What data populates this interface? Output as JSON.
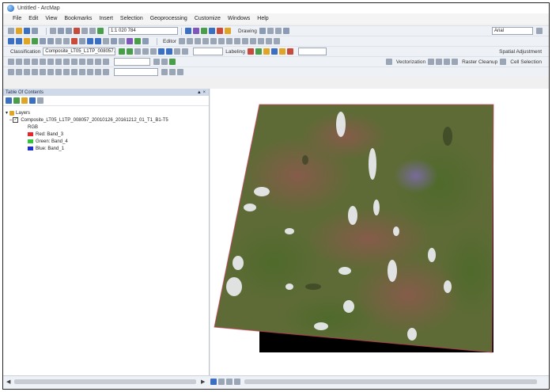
{
  "window": {
    "title": "Untitled - ArcMap"
  },
  "menubar": {
    "items": [
      "File",
      "Edit",
      "View",
      "Bookmarks",
      "Insert",
      "Selection",
      "Geoprocessing",
      "Customize",
      "Windows",
      "Help"
    ]
  },
  "toolbar1": {
    "scale": "1:1 020 784",
    "drawing_label": "Drawing",
    "font_label": "Arial"
  },
  "toolbar2": {
    "editor_label": "Editor"
  },
  "toolbar3": {
    "image_class_label": "Classification",
    "layer_combo": "Composite_LT05_L1TP_008057...",
    "labeling_label": "Labeling",
    "spatial_adjust_label": "Spatial Adjustment"
  },
  "toolbar4": {
    "vectorization_label": "Vectorization",
    "raster_cleanup_label": "Raster Cleanup",
    "cell_selection_label": "Cell Selection"
  },
  "toc": {
    "title": "Table Of Contents",
    "group_label": "Layers",
    "layer_name": "Composite_LT05_L1TP_008057_20010126_20161212_01_T1_B1-T5",
    "renderer_label": "RGB",
    "bands": [
      {
        "label": "Red:   Band_3",
        "color": "#e8262a"
      },
      {
        "label": "Green: Band_4",
        "color": "#2fc63a"
      },
      {
        "label": "Blue:  Band_1",
        "color": "#1f2fd6"
      }
    ]
  },
  "colors": {
    "toc_header": "#cfd9e8",
    "map_background": "#000000",
    "raster_base": "#5e6b36"
  },
  "icons": [
    "arcmap-app-icon",
    "new-icon",
    "open-icon",
    "save-icon",
    "print-icon",
    "cut-icon",
    "copy-icon",
    "paste-icon",
    "delete-icon",
    "undo-icon",
    "redo-icon",
    "add-data-icon",
    "zoom-in-icon",
    "zoom-out-icon",
    "pan-icon",
    "full-extent-icon",
    "identify-icon",
    "select-icon",
    "toc-pin-icon",
    "layer-checkbox-icon",
    "scroll-left-icon",
    "scroll-right-icon"
  ]
}
